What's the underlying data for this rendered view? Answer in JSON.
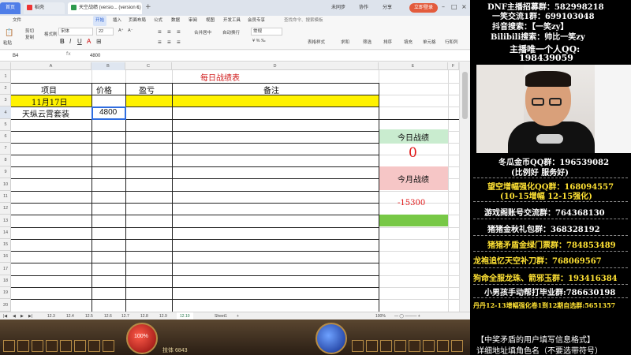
{
  "titlebar": {
    "tabs": [
      {
        "label": "首页"
      },
      {
        "label": "稻壳"
      },
      {
        "label": "天空战绩 (versio... (version 1)"
      }
    ],
    "login": "立即登录",
    "right_items": [
      "未同步",
      "协作",
      "分享"
    ]
  },
  "menubar": {
    "file": "文件",
    "items": [
      "开始",
      "插入",
      "页面布局",
      "公式",
      "数据",
      "审阅",
      "视图",
      "开发工具",
      "会员专享"
    ],
    "search": "查找命令、搜索模板"
  },
  "toolbar": {
    "paste": "粘贴",
    "cut": "剪切",
    "copy": "复制",
    "format_painter": "格式刷",
    "font": "宋体",
    "font_size": "22",
    "merge": "合并居中",
    "wrap": "自动换行",
    "number_format": "常规",
    "table_style": "表格样式",
    "sum": "求和",
    "filter": "筛选",
    "sort": "排序",
    "fill": "填充",
    "cell": "单元格",
    "row_col": "行和列"
  },
  "formula_bar": {
    "name_box": "B4",
    "fx": "fx",
    "value": "4800"
  },
  "columns": [
    "A",
    "B",
    "C",
    "D",
    "E",
    "F"
  ],
  "rows": [
    "1",
    "2",
    "3",
    "4",
    "5",
    "6",
    "7",
    "8",
    "9",
    "10",
    "11",
    "12",
    "13",
    "14",
    "15",
    "16",
    "17",
    "18",
    "19",
    "20"
  ],
  "sheet": {
    "title": "每日战绩表",
    "headers": {
      "item": "项目",
      "price": "价格",
      "profit": "盈亏",
      "note": "备注"
    },
    "date": "11月17日",
    "item1": "天纵云霄套装",
    "price1": "4800",
    "today_label": "今日战绩",
    "today_value": "0",
    "month_label": "今月战绩",
    "month_value": "-15300"
  },
  "sheet_tabs": [
    "12.3",
    "12.4",
    "12.5",
    "12.6",
    "12.7",
    "12.8",
    "12.9",
    "12.10",
    "Sheet1"
  ],
  "zoom": "100%",
  "game": {
    "hp": "100%",
    "level_text": "技体 6843"
  },
  "overlay": {
    "lines": [
      "DNF主播招募群：582998218",
      "一笑交流1群：699103048",
      "抖音搜索：【一笑zy】",
      "Bilibili搜索：帅比一笑zy",
      "主播唯一个人QQ:",
      "198439059",
      "冬瓜金币QQ群：196539082",
      "(比例好 服务好)",
      "望空增幅强化QQ群：168094557",
      "(10-15增幅 12-15强化)",
      "游戏阁账号交流群：764368130",
      "猪猪金秋礼包群：368328192",
      "猪猪矛盾金绿门票群：784853489",
      "龙袍追忆天空补刀群：768069567",
      "狗命全服龙珠、箭邪玉群：193416384",
      "小男孩手动帮打毕业群:786630198",
      "丹丹12-13增幅强化卷1到12期自选群:5651357",
      "【中奖矛盾的用户填写信息格式】",
      "详细地址填角色名（不要选带符号）"
    ]
  }
}
